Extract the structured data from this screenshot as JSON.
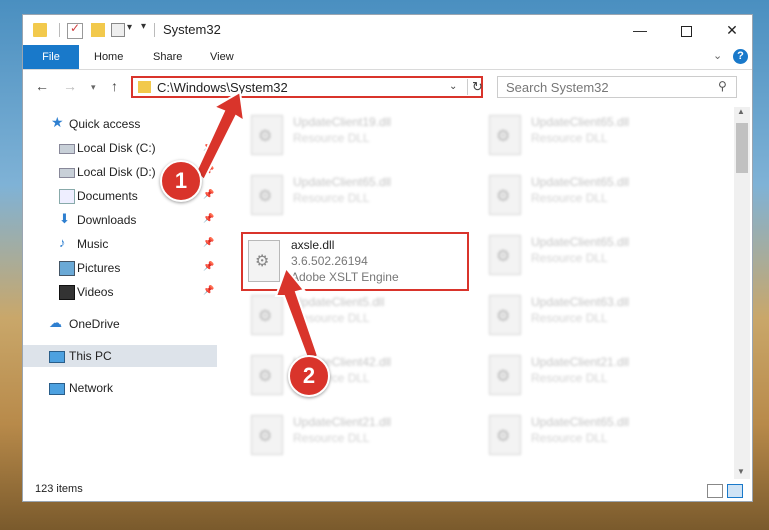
{
  "window": {
    "title": "System32",
    "minimize": "—",
    "close": "✕"
  },
  "ribbon": {
    "tabs": [
      "File",
      "Home",
      "Share",
      "View"
    ],
    "collapse": "⌄",
    "help": "?"
  },
  "nav": {
    "address": "C:\\Windows\\System32",
    "search_placeholder": "Search System32"
  },
  "sidebar": {
    "items": [
      {
        "label": "Quick access",
        "icon": "star-icon",
        "pinned": false
      },
      {
        "label": "Local Disk (C:)",
        "icon": "disk-icon",
        "pinned": true
      },
      {
        "label": "Local Disk (D:)",
        "icon": "disk-icon",
        "pinned": true
      },
      {
        "label": "Documents",
        "icon": "documents-icon",
        "pinned": true
      },
      {
        "label": "Downloads",
        "icon": "download-icon",
        "pinned": true
      },
      {
        "label": "Music",
        "icon": "music-icon",
        "pinned": true
      },
      {
        "label": "Pictures",
        "icon": "pictures-icon",
        "pinned": true
      },
      {
        "label": "Videos",
        "icon": "videos-icon",
        "pinned": true
      },
      {
        "label": "OneDrive",
        "icon": "cloud-icon",
        "pinned": false
      },
      {
        "label": "This PC",
        "icon": "computer-icon",
        "pinned": false,
        "selected": true
      },
      {
        "label": "Network",
        "icon": "network-icon",
        "pinned": false
      }
    ]
  },
  "files": {
    "left": [
      {
        "name": "UpdateClient19.dll",
        "desc": "Resource DLL"
      },
      {
        "name": "UpdateClient65.dll",
        "desc": "Resource DLL"
      }
    ],
    "left_lower": [
      {
        "name": "UpdateClient5.dll",
        "desc": "Resource DLL"
      },
      {
        "name": "UpdateClient42.dll",
        "desc": "Resource DLL"
      },
      {
        "name": "UpdateClient21.dll",
        "desc": "Resource DLL"
      }
    ],
    "right": [
      {
        "name": "UpdateClient65.dll",
        "desc": "Resource DLL"
      },
      {
        "name": "UpdateClient65.dll",
        "desc": "Resource DLL"
      },
      {
        "name": "UpdateClient65.dll",
        "desc": "Resource DLL"
      },
      {
        "name": "UpdateClient63.dll",
        "desc": "Resource DLL"
      },
      {
        "name": "UpdateClient21.dll",
        "desc": "Resource DLL"
      },
      {
        "name": "UpdateClient65.dll",
        "desc": "Resource DLL"
      }
    ],
    "highlighted": {
      "name": "axsle.dll",
      "version": "3.6.502.26194",
      "description": "Adobe XSLT Engine"
    }
  },
  "status": {
    "item_count": "123 items"
  },
  "callouts": [
    "1",
    "2"
  ],
  "colors": {
    "accent": "#1979ca",
    "highlight_red": "#d9342b"
  }
}
